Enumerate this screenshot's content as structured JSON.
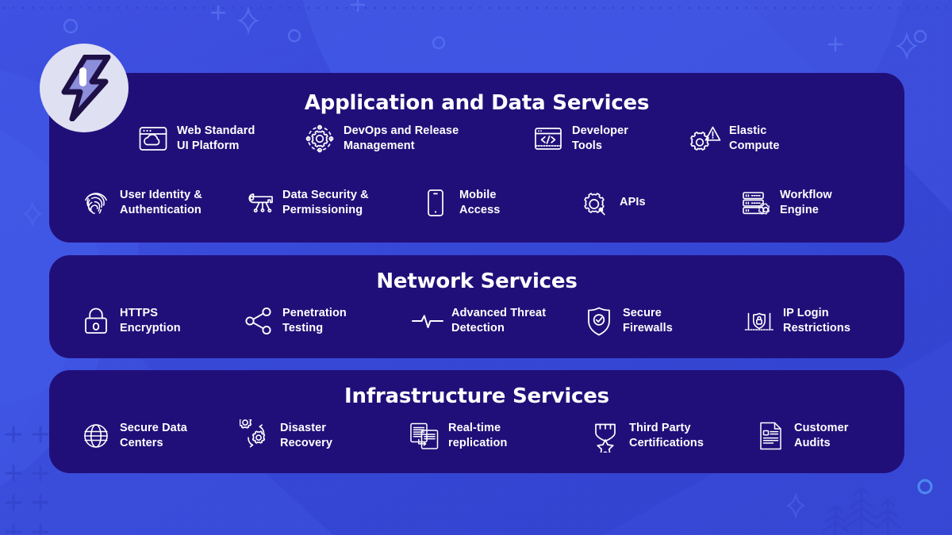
{
  "logo": {
    "name": "lightning-bolt-logo",
    "fill": "#8c8edc",
    "stroke": "#1e1046",
    "badge_bg": "#dfe1f2"
  },
  "theme": {
    "background": "#3a4bd8",
    "panel": "#210f79",
    "text": "#ffffff",
    "accent": "#4f63e8"
  },
  "panels": [
    {
      "id": "application-and-data-services",
      "title": "Application and Data Services",
      "rows": [
        [
          {
            "icon": "browser-cloud-icon",
            "label": "Web Standard\nUI Platform"
          },
          {
            "icon": "gear-orbit-icon",
            "label": "DevOps and Release\nManagement"
          },
          {
            "icon": "code-window-icon",
            "label": "Developer\nTools"
          },
          {
            "icon": "gear-warning-icon",
            "label": "Elastic\nCompute"
          }
        ],
        [
          {
            "icon": "fingerprint-icon",
            "label": "User Identity &\nAuthentication"
          },
          {
            "icon": "key-network-icon",
            "label": "Data Security &\nPermissioning"
          },
          {
            "icon": "mobile-phone-icon",
            "label": "Mobile\nAccess"
          },
          {
            "icon": "gear-magnifier-icon",
            "label": "APIs"
          },
          {
            "icon": "server-gear-icon",
            "label": "Workflow\nEngine"
          }
        ]
      ]
    },
    {
      "id": "network-services",
      "title": "Network Services",
      "rows": [
        [
          {
            "icon": "padlock-icon",
            "label": "HTTPS\nEncryption"
          },
          {
            "icon": "share-nodes-icon",
            "label": "Penetration\nTesting"
          },
          {
            "icon": "pulse-line-icon",
            "label": "Advanced Threat\nDetection"
          },
          {
            "icon": "shield-check-icon",
            "label": "Secure\nFirewalls"
          },
          {
            "icon": "laptop-lock-icon",
            "label": "IP Login\nRestrictions"
          }
        ]
      ]
    },
    {
      "id": "infrastructure-services",
      "title": "Infrastructure Services",
      "rows": [
        [
          {
            "icon": "globe-icon",
            "label": "Secure Data\nCenters"
          },
          {
            "icon": "gears-recycle-icon",
            "label": "Disaster\nRecovery"
          },
          {
            "icon": "documents-sync-icon",
            "label": "Real-time\nreplication"
          },
          {
            "icon": "badge-star-icon",
            "label": "Third Party\nCertifications"
          },
          {
            "icon": "document-lines-icon",
            "label": "Customer\nAudits"
          }
        ]
      ]
    }
  ]
}
